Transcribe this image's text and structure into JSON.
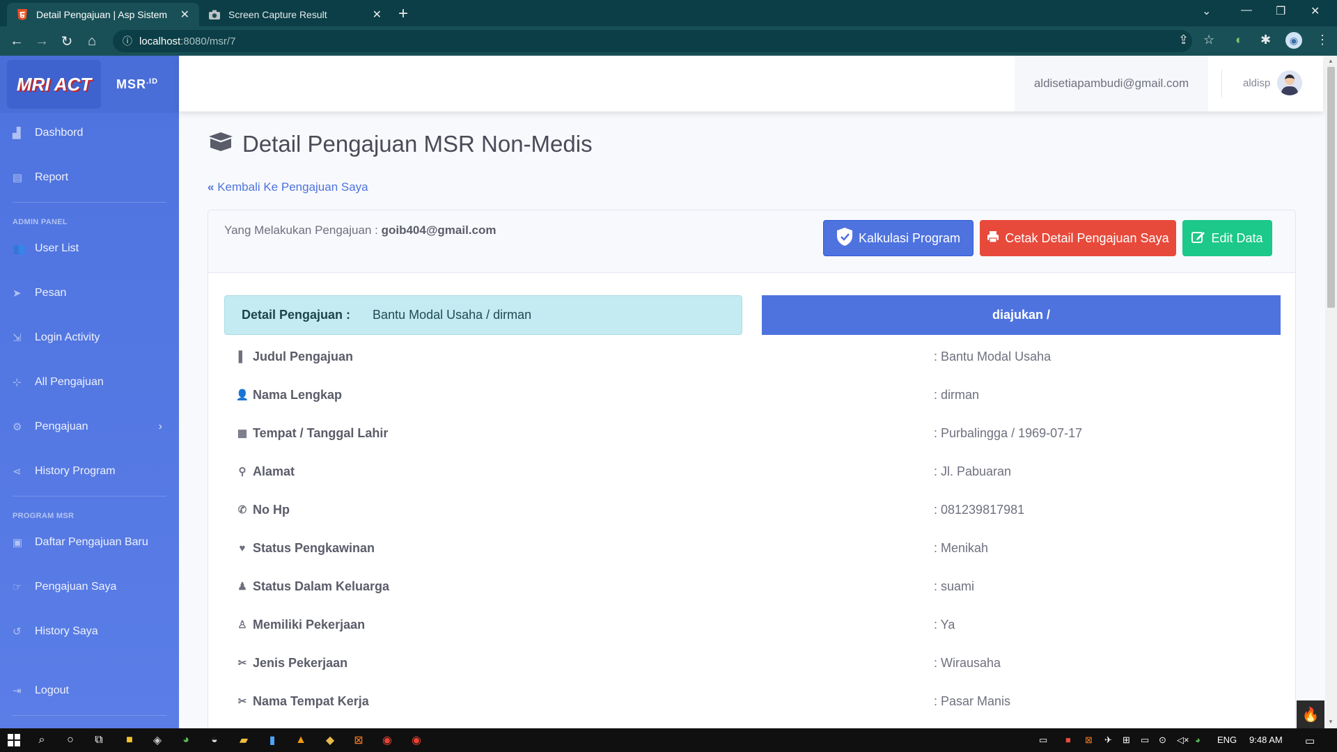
{
  "browser": {
    "tabs": [
      {
        "title": "Detail Pengajuan | Asp Sistem",
        "active": true,
        "icon": "html5-icon"
      },
      {
        "title": "Screen Capture Result",
        "active": false,
        "icon": "camera-icon"
      }
    ],
    "url_host": "localhost",
    "url_path": ":8080/msr/7"
  },
  "sidebar": {
    "brand_logo_text": "MRI ACT",
    "brand_name": "MSR",
    "brand_suffix": ".ID",
    "items": [
      {
        "label": "Dashbord",
        "icon": "dashboard-icon"
      },
      {
        "label": "Report",
        "icon": "report-icon"
      },
      {
        "label": "User List",
        "icon": "users-icon"
      },
      {
        "label": "Pesan",
        "icon": "paper-plane-icon"
      },
      {
        "label": "Login Activity",
        "icon": "login-icon"
      },
      {
        "label": "All Pengajuan",
        "icon": "sitemap-icon"
      },
      {
        "label": "Pengajuan",
        "icon": "users-cog-icon"
      },
      {
        "label": "History Program",
        "icon": "share-icon"
      },
      {
        "label": "Daftar Pengajuan Baru",
        "icon": "briefcase-icon"
      },
      {
        "label": "Pengajuan Saya",
        "icon": "hand-icon"
      },
      {
        "label": "History Saya",
        "icon": "history-icon"
      },
      {
        "label": "Logout",
        "icon": "logout-icon"
      }
    ],
    "headings": {
      "admin": "ADMIN PANEL",
      "program": "PROGRAM MSR"
    }
  },
  "topbar": {
    "email": "aldisetiapambudi@gmail.com",
    "username": "aldisp"
  },
  "main": {
    "title": "Detail Pengajuan MSR Non-Medis",
    "back_link": "Kembali Ke Pengajuan Saya",
    "submitter_label": "Yang Melakukan Pengajuan :",
    "submitter_email": "goib404@gmail.com",
    "buttons": {
      "kalkulasi": "Kalkulasi Program",
      "cetak": "Cetak Detail Pengajuan Saya",
      "edit": "Edit Data"
    },
    "detail_label": "Detail Pengajuan :",
    "detail_value": "Bantu Modal Usaha / dirman",
    "status": "diajukan /",
    "rows": [
      {
        "label": "Judul Pengajuan",
        "value": ": Bantu Modal Usaha",
        "icon": "info-icon"
      },
      {
        "label": "Nama Lengkap",
        "value": ": dirman",
        "icon": "user-icon"
      },
      {
        "label": "Tempat / Tanggal Lahir",
        "value": ": Purbalingga / 1969-07-17",
        "icon": "calendar-icon"
      },
      {
        "label": "Alamat",
        "value": ": Jl. Pabuaran",
        "icon": "map-marker-icon"
      },
      {
        "label": "No Hp",
        "value": ": 081239817981",
        "icon": "phone-icon"
      },
      {
        "label": "Status Pengkawinan",
        "value": ": Menikah",
        "icon": "heart-icon"
      },
      {
        "label": "Status Dalam Keluarga",
        "value": ": suami",
        "icon": "person-icon"
      },
      {
        "label": "Memiliki Pekerjaan",
        "value": ": Ya",
        "icon": "worker-icon"
      },
      {
        "label": "Jenis Pekerjaan",
        "value": ": Wirausaha",
        "icon": "tools-icon"
      },
      {
        "label": "Nama Tempat Kerja",
        "value": ": Pasar Manis",
        "icon": "tools-icon"
      }
    ]
  },
  "taskbar": {
    "language": "ENG",
    "time": "9:48 AM"
  },
  "colors": {
    "primary": "#4e73df",
    "danger": "#e74a3b",
    "success": "#1cc88a",
    "chrome": "#195057"
  }
}
